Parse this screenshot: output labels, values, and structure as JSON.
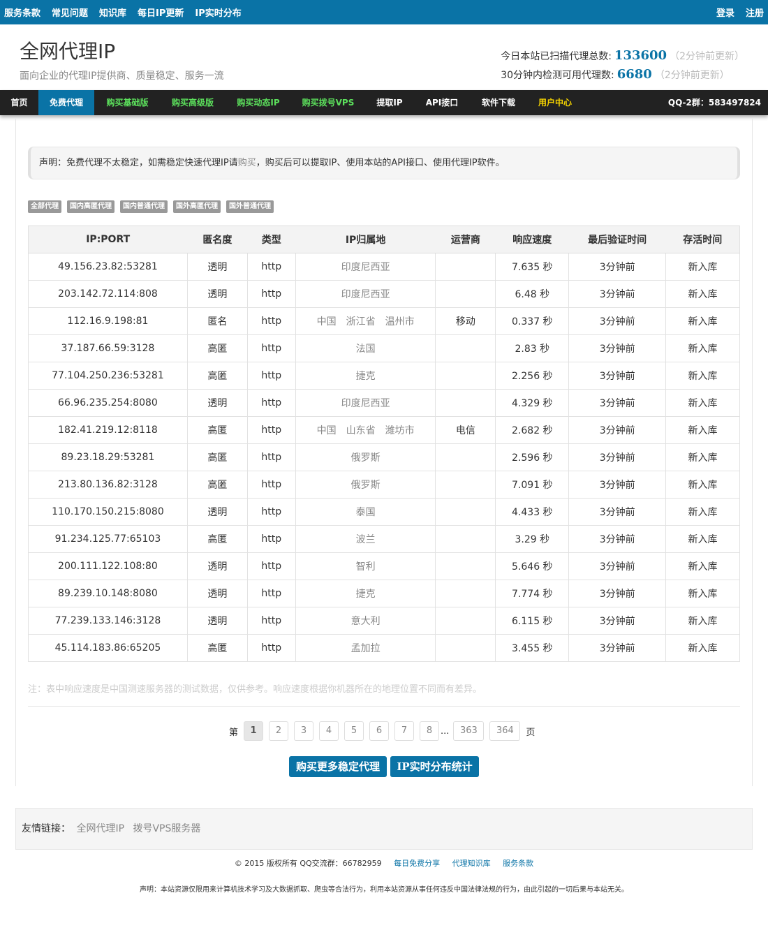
{
  "topbar": {
    "links": [
      "服务条款",
      "常见问题",
      "知识库",
      "每日IP更新",
      "IP实时分布"
    ],
    "login": "登录",
    "register": "注册"
  },
  "header": {
    "title": "全网代理IP",
    "subtitle": "面向企业的代理IP提供商、质量稳定、服务一流",
    "stat1_label": "今日本站已扫描代理总数:",
    "stat1_value": "133600",
    "stat1_note": "（2分钟前更新）",
    "stat2_label": "30分钟内检测可用代理数:",
    "stat2_value": "6680",
    "stat2_note": "（2分钟前更新）"
  },
  "nav": {
    "items": [
      "首页",
      "免费代理",
      "购买基础版",
      "购买高级版",
      "购买动态IP",
      "购买拨号VPS",
      "提取IP",
      "API接口",
      "软件下载",
      "用户中心"
    ],
    "qq": "QQ-2群：583497824"
  },
  "notice": {
    "text_before": "声明：免费代理不太稳定，如需稳定快速代理IP请",
    "link": "购买",
    "text_after": "，购买后可以提取IP、使用本站的API接口、使用代理IP软件。"
  },
  "filters": [
    "全部代理",
    "国内高匿代理",
    "国内普通代理",
    "国外高匿代理",
    "国外普通代理"
  ],
  "table": {
    "headers": [
      "IP:PORT",
      "匿名度",
      "类型",
      "IP归属地",
      "运营商",
      "响应速度",
      "最后验证时间",
      "存活时间"
    ],
    "rows": [
      {
        "ip": "49.156.23.82:53281",
        "anon": "透明",
        "type": "http",
        "loc": [
          "印度尼西亚"
        ],
        "isp": "",
        "speed": "7.635 秒",
        "verified": "3分钟前",
        "alive": "新入库"
      },
      {
        "ip": "203.142.72.114:808",
        "anon": "透明",
        "type": "http",
        "loc": [
          "印度尼西亚"
        ],
        "isp": "",
        "speed": "6.48 秒",
        "verified": "3分钟前",
        "alive": "新入库"
      },
      {
        "ip": "112.16.9.198:81",
        "anon": "匿名",
        "type": "http",
        "loc": [
          "中国",
          "浙江省",
          "温州市"
        ],
        "isp": "移动",
        "speed": "0.337 秒",
        "verified": "3分钟前",
        "alive": "新入库"
      },
      {
        "ip": "37.187.66.59:3128",
        "anon": "高匿",
        "type": "http",
        "loc": [
          "法国"
        ],
        "isp": "",
        "speed": "2.83 秒",
        "verified": "3分钟前",
        "alive": "新入库"
      },
      {
        "ip": "77.104.250.236:53281",
        "anon": "高匿",
        "type": "http",
        "loc": [
          "捷克"
        ],
        "isp": "",
        "speed": "2.256 秒",
        "verified": "3分钟前",
        "alive": "新入库"
      },
      {
        "ip": "66.96.235.254:8080",
        "anon": "透明",
        "type": "http",
        "loc": [
          "印度尼西亚"
        ],
        "isp": "",
        "speed": "4.329 秒",
        "verified": "3分钟前",
        "alive": "新入库"
      },
      {
        "ip": "182.41.219.12:8118",
        "anon": "高匿",
        "type": "http",
        "loc": [
          "中国",
          "山东省",
          "潍坊市"
        ],
        "isp": "电信",
        "speed": "2.682 秒",
        "verified": "3分钟前",
        "alive": "新入库"
      },
      {
        "ip": "89.23.18.29:53281",
        "anon": "高匿",
        "type": "http",
        "loc": [
          "俄罗斯"
        ],
        "isp": "",
        "speed": "2.596 秒",
        "verified": "3分钟前",
        "alive": "新入库"
      },
      {
        "ip": "213.80.136.82:3128",
        "anon": "高匿",
        "type": "http",
        "loc": [
          "俄罗斯"
        ],
        "isp": "",
        "speed": "7.091 秒",
        "verified": "3分钟前",
        "alive": "新入库"
      },
      {
        "ip": "110.170.150.215:8080",
        "anon": "透明",
        "type": "http",
        "loc": [
          "泰国"
        ],
        "isp": "",
        "speed": "4.433 秒",
        "verified": "3分钟前",
        "alive": "新入库"
      },
      {
        "ip": "91.234.125.77:65103",
        "anon": "高匿",
        "type": "http",
        "loc": [
          "波兰"
        ],
        "isp": "",
        "speed": "3.29 秒",
        "verified": "3分钟前",
        "alive": "新入库"
      },
      {
        "ip": "200.111.122.108:80",
        "anon": "透明",
        "type": "http",
        "loc": [
          "智利"
        ],
        "isp": "",
        "speed": "5.646 秒",
        "verified": "3分钟前",
        "alive": "新入库"
      },
      {
        "ip": "89.239.10.148:8080",
        "anon": "透明",
        "type": "http",
        "loc": [
          "捷克"
        ],
        "isp": "",
        "speed": "7.774 秒",
        "verified": "3分钟前",
        "alive": "新入库"
      },
      {
        "ip": "77.239.133.146:3128",
        "anon": "透明",
        "type": "http",
        "loc": [
          "意大利"
        ],
        "isp": "",
        "speed": "6.115 秒",
        "verified": "3分钟前",
        "alive": "新入库"
      },
      {
        "ip": "45.114.183.86:65205",
        "anon": "高匿",
        "type": "http",
        "loc": [
          "孟加拉"
        ],
        "isp": "",
        "speed": "3.455 秒",
        "verified": "3分钟前",
        "alive": "新入库"
      }
    ]
  },
  "footnote": "注：表中响应速度是中国测速服务器的测试数据，仅供参考。响应速度根据你机器所在的地理位置不同而有差异。",
  "pager": {
    "prefix": "第",
    "pages": [
      "1",
      "2",
      "3",
      "4",
      "5",
      "6",
      "7",
      "8"
    ],
    "current": "1",
    "ellipsis": "...",
    "tail": [
      "363",
      "364"
    ],
    "suffix": "页"
  },
  "buttons": {
    "buy": "购买更多稳定代理",
    "dist": "IP实时分布统计"
  },
  "friends": {
    "label": "友情链接：",
    "links": [
      "全网代理IP",
      "拨号VPS服务器"
    ]
  },
  "footer": {
    "copyright": "© 2015 版权所有   QQ交流群：66782959",
    "links": [
      "每日免费分享",
      "代理知识库",
      "服务条款"
    ],
    "disclaimer": "声明：本站资源仅限用来计算机技术学习及大数据抓取、爬虫等合法行为，利用本站资源从事任何违反中国法律法规的行为，由此引起的一切后果与本站无关。"
  },
  "colors": {
    "brand": "#0a73a6",
    "nav_bg": "#222222",
    "high_anon": "#cc0000",
    "nav_green": "#5ce05c",
    "nav_yellow": "#f5d300"
  }
}
